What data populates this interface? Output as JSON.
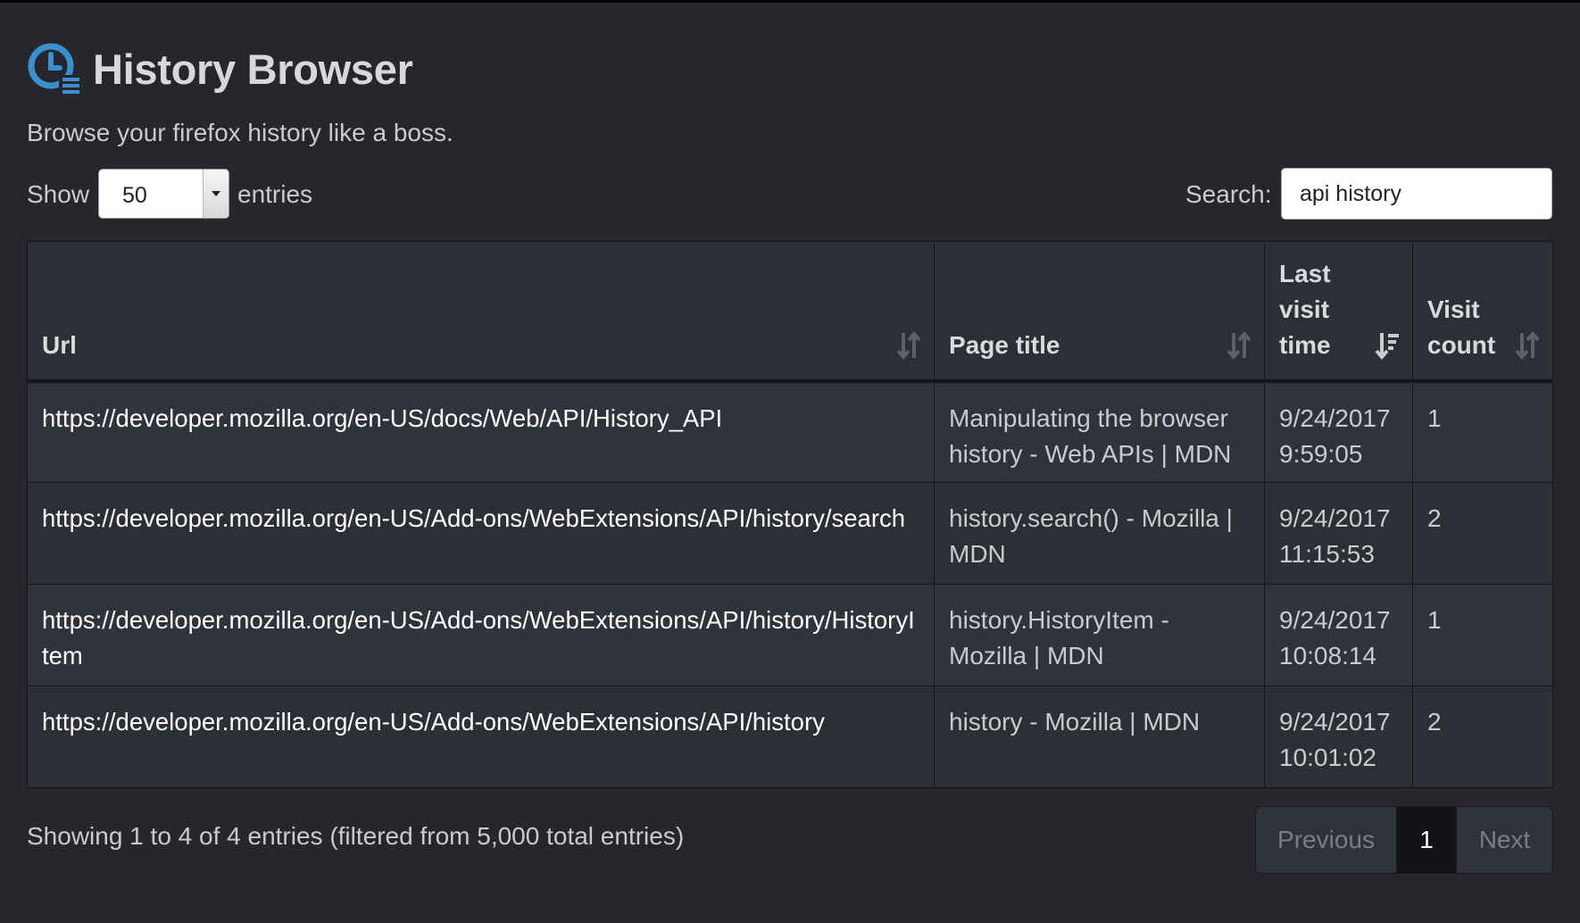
{
  "app": {
    "title": "History Browser",
    "subtitle": "Browse your firefox history like a boss.",
    "logo_icon": "clock-history-icon"
  },
  "controls": {
    "show_label": "Show",
    "page_length": "50",
    "entries_label": "entries",
    "search_label": "Search:",
    "search_value": "api history"
  },
  "table": {
    "columns": [
      {
        "label": "Url",
        "sort": "unsorted"
      },
      {
        "label": "Page title",
        "sort": "unsorted"
      },
      {
        "label": "Last visit time",
        "sort": "descending"
      },
      {
        "label": "Visit count",
        "sort": "unsorted"
      }
    ],
    "rows": [
      {
        "url": "https://developer.mozilla.org/en-US/docs/Web/API/History_API",
        "title": "Manipulating the browser history - Web APIs | MDN",
        "last_visit": "9/24/2017 9:59:05",
        "count": "1"
      },
      {
        "url": "https://developer.mozilla.org/en-US/Add-ons/WebExtensions/API/history/search",
        "title": "history.search() - Mozilla | MDN",
        "last_visit": "9/24/2017 11:15:53",
        "count": "2"
      },
      {
        "url": "https://developer.mozilla.org/en-US/Add-ons/WebExtensions/API/history/HistoryItem",
        "title": "history.HistoryItem - Mozilla | MDN",
        "last_visit": "9/24/2017 10:08:14",
        "count": "1"
      },
      {
        "url": "https://developer.mozilla.org/en-US/Add-ons/WebExtensions/API/history",
        "title": "history - Mozilla | MDN",
        "last_visit": "9/24/2017 10:01:02",
        "count": "2"
      }
    ]
  },
  "footer": {
    "info": "Showing 1 to 4 of 4 entries (filtered from 5,000 total entries)",
    "previous": "Previous",
    "current_page": "1",
    "next": "Next"
  },
  "colors": {
    "background": "#25272d",
    "logo_blue": "#3b8fd0",
    "text": "#c9cbcf",
    "url_text": "#ffffff"
  }
}
